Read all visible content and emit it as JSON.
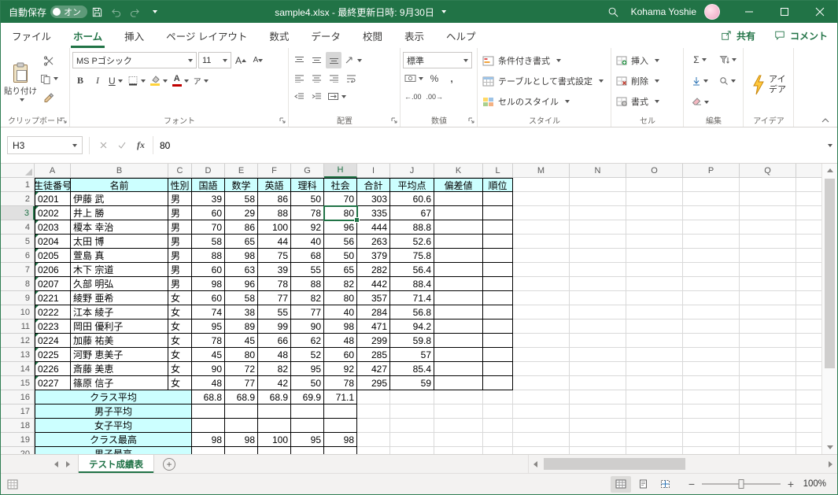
{
  "title_bar": {
    "autosave_label": "自動保存",
    "autosave_state": "オン",
    "document_title": "sample4.xlsx - 最終更新日時: 9月30日",
    "user_name": "Kohama Yoshie"
  },
  "ribbon_tabs": {
    "file": "ファイル",
    "items": [
      "ホーム",
      "挿入",
      "ページ レイアウト",
      "数式",
      "データ",
      "校閲",
      "表示",
      "ヘルプ"
    ],
    "active": "ホーム",
    "share_label": "共有",
    "comments_label": "コメント"
  },
  "ribbon": {
    "clipboard": {
      "label": "クリップボード",
      "paste_label": "貼り付け"
    },
    "font": {
      "label": "フォント",
      "font_name": "MS Pゴシック",
      "font_size": "11"
    },
    "alignment": {
      "label": "配置"
    },
    "number": {
      "label": "数値",
      "format": "標準"
    },
    "styles": {
      "label": "スタイル",
      "items": [
        "条件付き書式",
        "テーブルとして書式設定",
        "セルのスタイル"
      ]
    },
    "cells": {
      "label": "セル",
      "items": [
        "挿入",
        "削除",
        "書式"
      ]
    },
    "editing": {
      "label": "編集"
    },
    "ideas": {
      "label": "アイデア",
      "button_line1": "アイ",
      "button_line2": "デア"
    }
  },
  "icon_labels": {
    "b": "B",
    "i": "I",
    "u": "U",
    "font_grow": "A",
    "font_shrink": "A",
    "font_color": "A",
    "ruby": "ア",
    "percent": "%",
    "comma": ",",
    "increase_decimal": "←.00",
    "decrease_decimal": ".00→",
    "autosum": "Σ",
    "fx": "fx"
  },
  "formula_bar": {
    "name_box": "H3",
    "value": "80"
  },
  "grid": {
    "column_letters": [
      "A",
      "B",
      "C",
      "D",
      "E",
      "F",
      "G",
      "H",
      "I",
      "J",
      "K",
      "L",
      "M",
      "N",
      "O",
      "P",
      "Q"
    ],
    "selected_cell": {
      "ref": "H3",
      "column": "H",
      "row": 3
    },
    "header_row": [
      "生徒番号",
      "名前",
      "性別",
      "国語",
      "数学",
      "英語",
      "理科",
      "社会",
      "合計",
      "平均点",
      "偏差値",
      "順位"
    ],
    "students": [
      [
        "0201",
        "伊藤 武",
        "男",
        "39",
        "58",
        "86",
        "50",
        "70",
        "303",
        "60.6"
      ],
      [
        "0202",
        "井上 勝",
        "男",
        "60",
        "29",
        "88",
        "78",
        "80",
        "335",
        "67"
      ],
      [
        "0203",
        "榎本 幸治",
        "男",
        "70",
        "86",
        "100",
        "92",
        "96",
        "444",
        "88.8"
      ],
      [
        "0204",
        "太田 博",
        "男",
        "58",
        "65",
        "44",
        "40",
        "56",
        "263",
        "52.6"
      ],
      [
        "0205",
        "萱島 真",
        "男",
        "88",
        "98",
        "75",
        "68",
        "50",
        "379",
        "75.8"
      ],
      [
        "0206",
        "木下 宗道",
        "男",
        "60",
        "63",
        "39",
        "55",
        "65",
        "282",
        "56.4"
      ],
      [
        "0207",
        "久部 明弘",
        "男",
        "98",
        "96",
        "78",
        "88",
        "82",
        "442",
        "88.4"
      ],
      [
        "0221",
        "綾野 亜希",
        "女",
        "60",
        "58",
        "77",
        "82",
        "80",
        "357",
        "71.4"
      ],
      [
        "0222",
        "江本 綾子",
        "女",
        "74",
        "38",
        "55",
        "77",
        "40",
        "284",
        "56.8"
      ],
      [
        "0223",
        "岡田 優利子",
        "女",
        "95",
        "89",
        "99",
        "90",
        "98",
        "471",
        "94.2"
      ],
      [
        "0224",
        "加藤 祐美",
        "女",
        "78",
        "45",
        "66",
        "62",
        "48",
        "299",
        "59.8"
      ],
      [
        "0225",
        "河野 恵美子",
        "女",
        "45",
        "80",
        "48",
        "52",
        "60",
        "285",
        "57"
      ],
      [
        "0226",
        "斎藤 美恵",
        "女",
        "90",
        "72",
        "82",
        "95",
        "92",
        "427",
        "85.4"
      ],
      [
        "0227",
        "篠原 信子",
        "女",
        "48",
        "77",
        "42",
        "50",
        "78",
        "295",
        "59"
      ]
    ],
    "summary_rows": [
      {
        "label": "クラス平均",
        "values": [
          "68.8",
          "68.9",
          "68.9",
          "69.9",
          "71.1"
        ]
      },
      {
        "label": "男子平均",
        "values": [
          "",
          "",
          "",
          "",
          ""
        ]
      },
      {
        "label": "女子平均",
        "values": [
          "",
          "",
          "",
          "",
          ""
        ]
      },
      {
        "label": "クラス最高",
        "values": [
          "98",
          "98",
          "100",
          "95",
          "98"
        ]
      },
      {
        "label": "男子最高",
        "values": [
          "",
          "",
          "",
          "",
          ""
        ]
      }
    ]
  },
  "sheet_tabs": {
    "active_tab": "テスト成績表"
  },
  "status_bar": {
    "zoom_level": "100%"
  }
}
